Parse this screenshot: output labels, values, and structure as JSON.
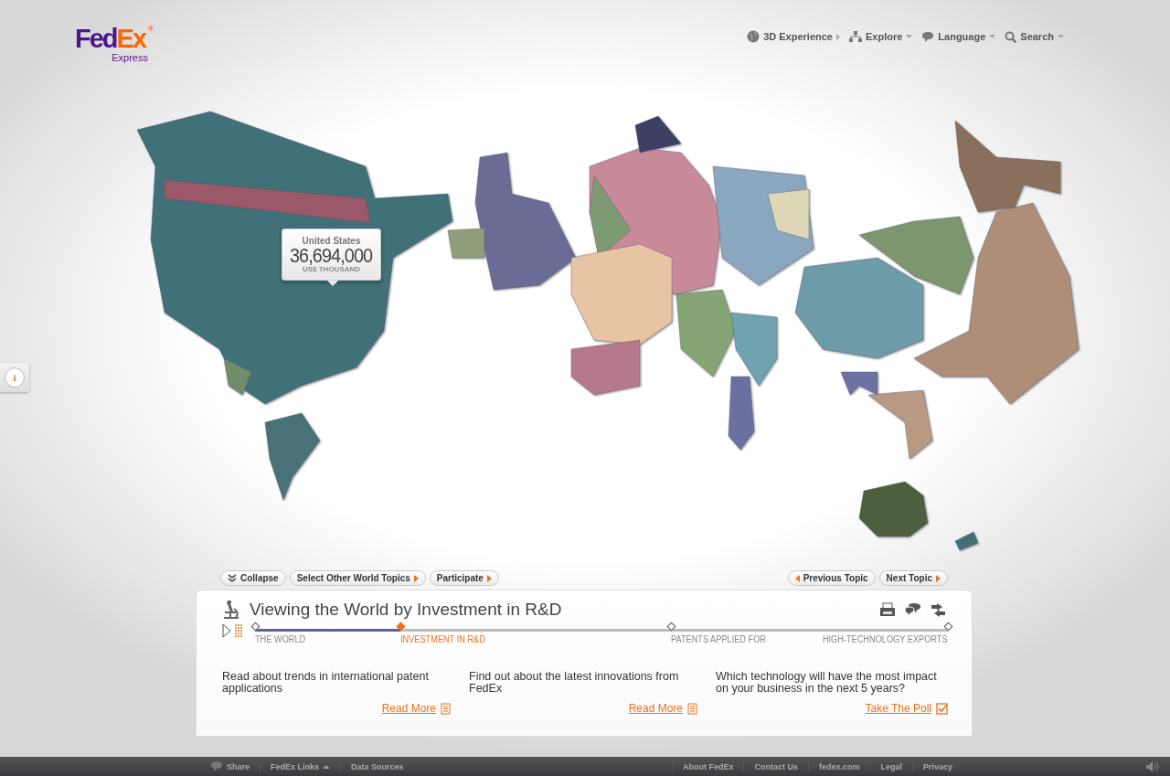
{
  "logo": {
    "brand_first": "Fed",
    "brand_second": "Ex",
    "registered": "®",
    "division": "Express"
  },
  "top_nav": [
    {
      "label": "3D Experience"
    },
    {
      "label": "Explore"
    },
    {
      "label": "Language"
    },
    {
      "label": "Search"
    }
  ],
  "map_tooltip": {
    "country": "United States",
    "value": "36,694,000",
    "unit": "US$ THOUSAND"
  },
  "info_button": {
    "label": "i"
  },
  "topic_toolbar": {
    "left": [
      {
        "label": "Collapse"
      },
      {
        "label": "Select Other World Topics"
      },
      {
        "label": "Participate"
      }
    ],
    "right": [
      {
        "label": "Previous Topic"
      },
      {
        "label": "Next Topic"
      }
    ]
  },
  "panel": {
    "title": "Viewing the World by Investment in R&D",
    "progress": {
      "level": 0.21
    },
    "stages": [
      {
        "label": "THE WORLD",
        "selected": false
      },
      {
        "label": "INVESTMENT IN R&D",
        "selected": true
      },
      {
        "label": "PATENTS APPLIED FOR",
        "selected": false
      },
      {
        "label": "HIGH-TECHNOLOGY EXPORTS",
        "selected": false
      }
    ],
    "cards": [
      {
        "kind": "article",
        "text": "Read about trends in international patent applications",
        "link": "Read More"
      },
      {
        "kind": "article",
        "text": "Find out about the latest innovations from FedEx",
        "link": "Read More"
      },
      {
        "kind": "poll",
        "text": "Which technology will have the most impact on your business in the next 5 years?",
        "link": "Take The Poll"
      }
    ]
  },
  "footer": {
    "left": [
      {
        "label": "Share"
      },
      {
        "label": "FedEx Links"
      },
      {
        "label": "Data Sources"
      }
    ],
    "right": [
      "About FedEx",
      "Contact Us",
      "fedex.com",
      "Legal",
      "Privacy"
    ]
  }
}
